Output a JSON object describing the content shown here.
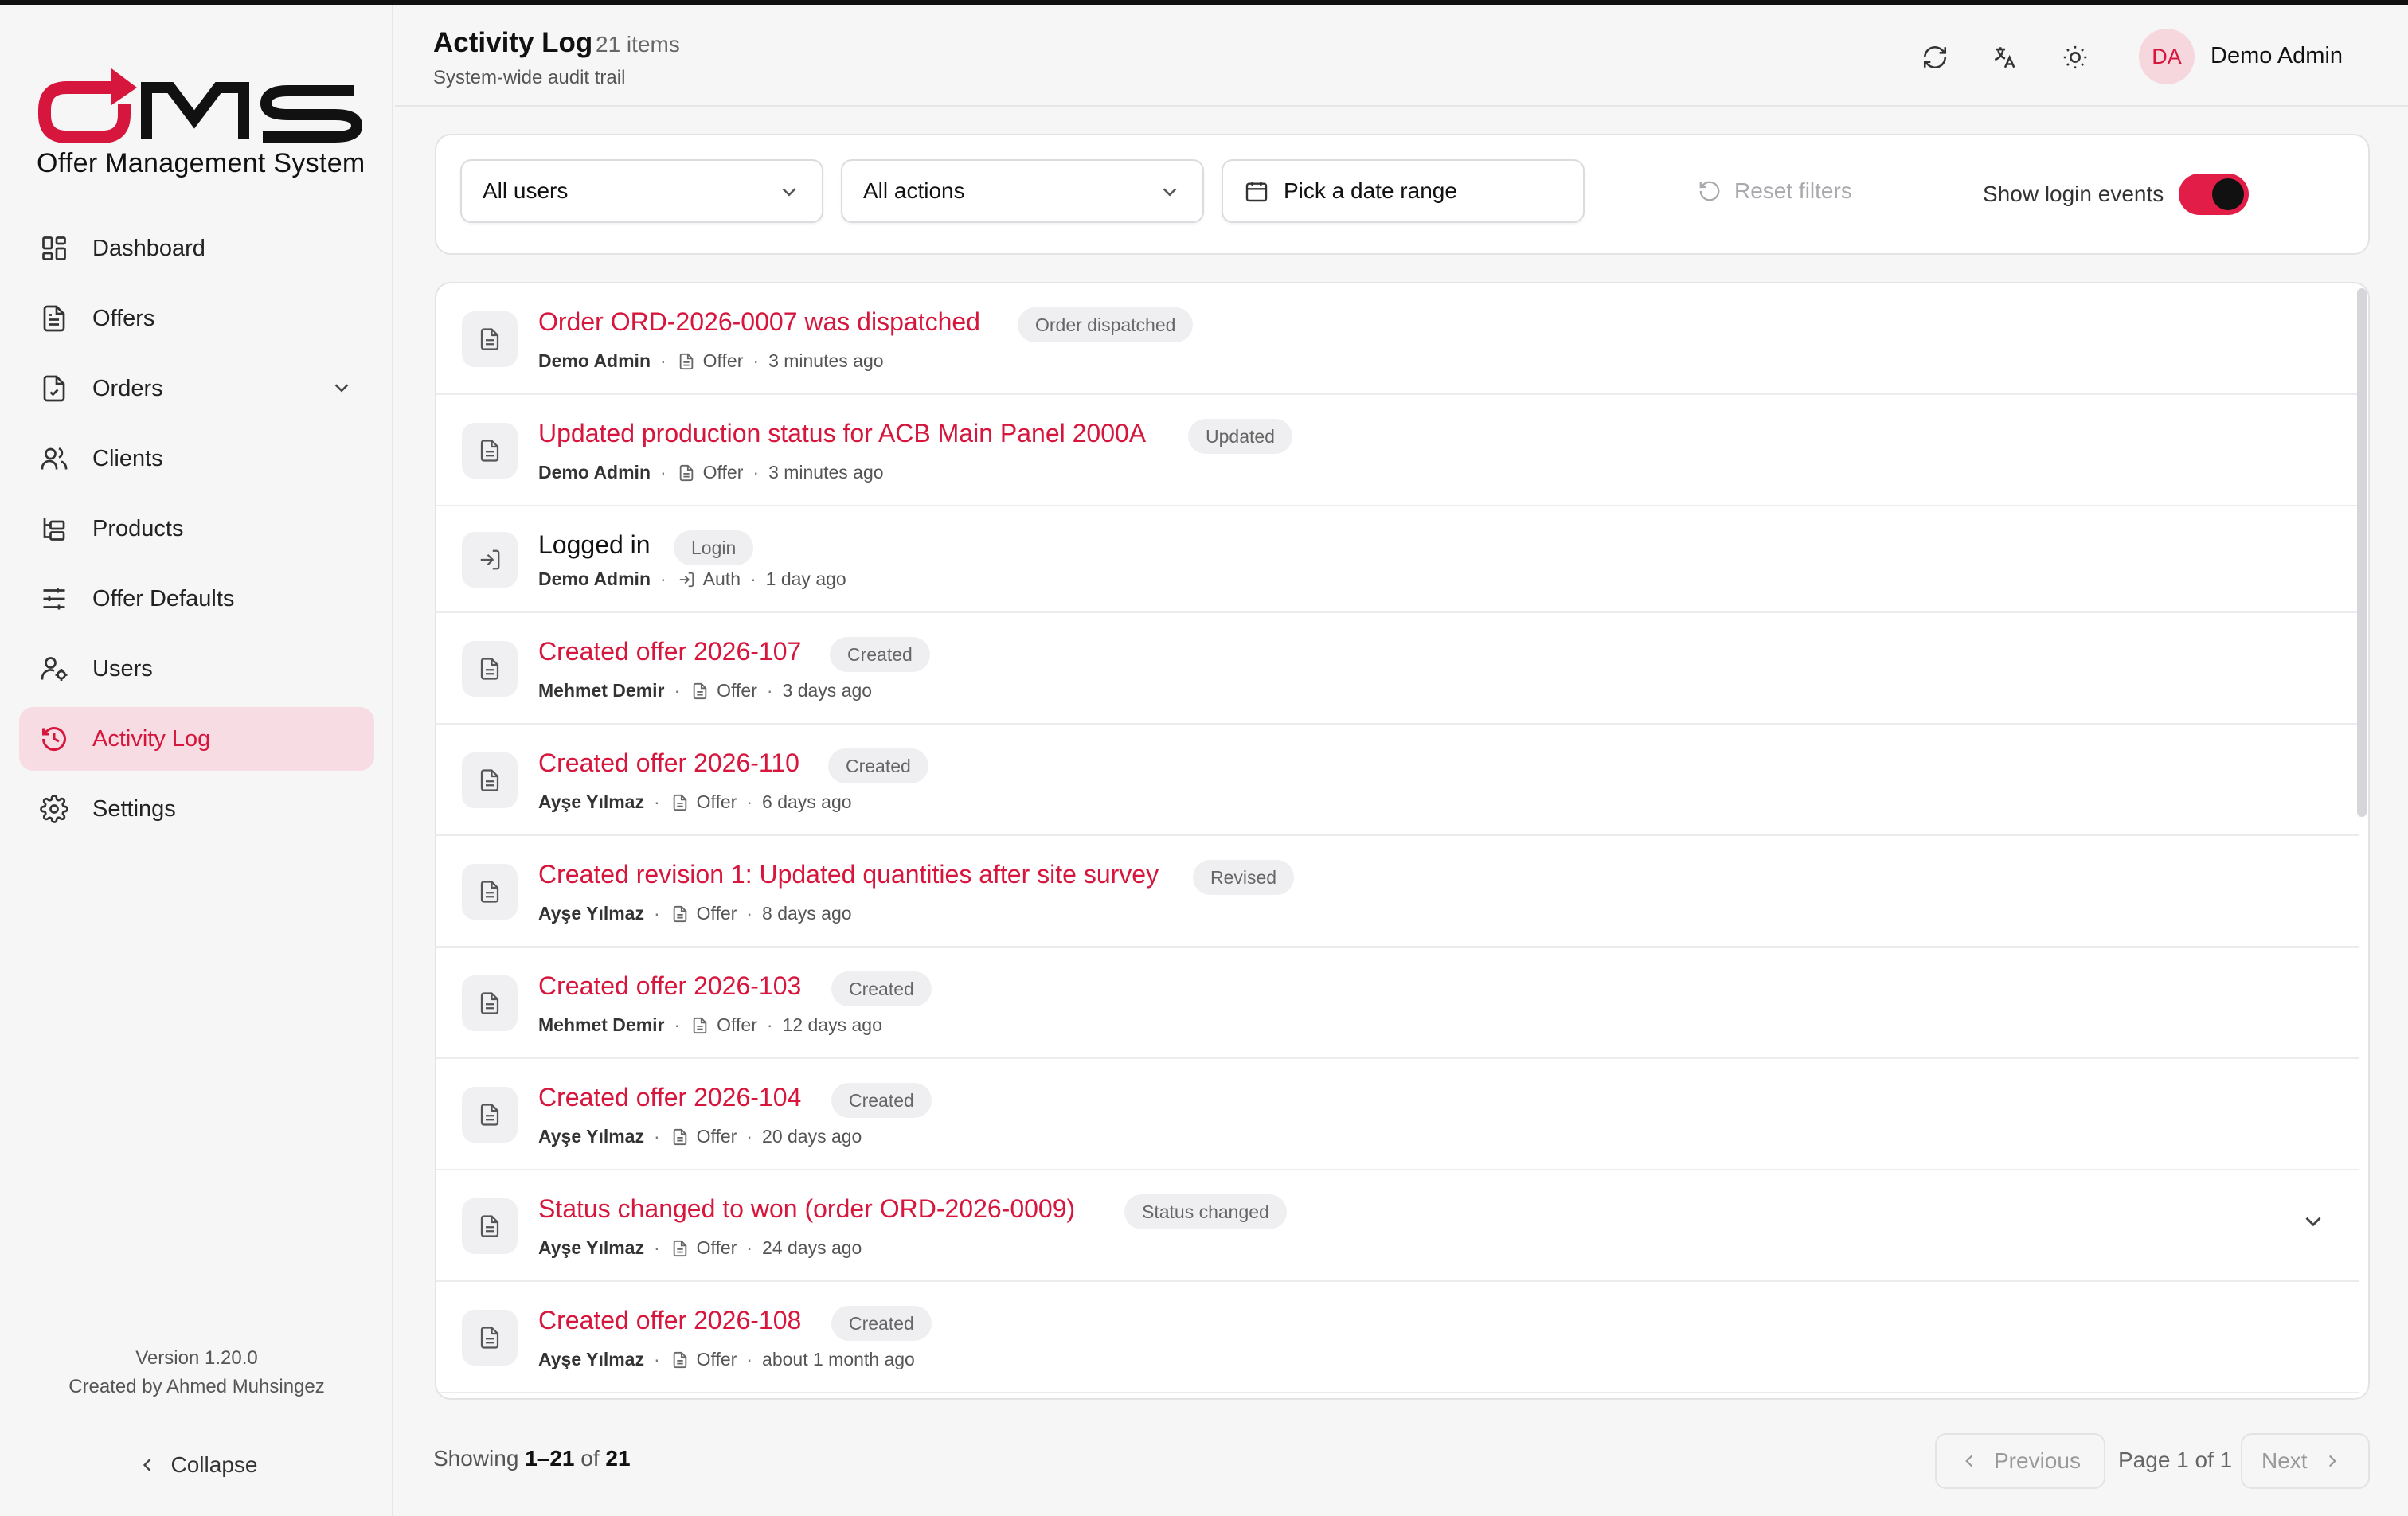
{
  "app": {
    "logo_text": "OMS",
    "logo_subtitle": "Offer Management System",
    "brand_color": "#d6163c"
  },
  "sidebar": {
    "items": [
      {
        "label": "Dashboard",
        "icon": "dashboard-grid-icon"
      },
      {
        "label": "Offers",
        "icon": "document-icon"
      },
      {
        "label": "Orders",
        "icon": "clipboard-check-icon",
        "has_submenu": true
      },
      {
        "label": "Clients",
        "icon": "users-icon"
      },
      {
        "label": "Products",
        "icon": "hierarchy-icon"
      },
      {
        "label": "Offer Defaults",
        "icon": "sliders-icon"
      },
      {
        "label": "Users",
        "icon": "user-gear-icon"
      },
      {
        "label": "Activity Log",
        "icon": "history-icon",
        "active": true
      },
      {
        "label": "Settings",
        "icon": "gear-icon"
      }
    ],
    "version": "Version 1.20.0",
    "credit": "Created by Ahmed Muhsingez",
    "collapse_label": "Collapse"
  },
  "header": {
    "title": "Activity Log",
    "count": "21 items",
    "subtitle": "System-wide audit trail",
    "user_initials": "DA",
    "user_name": "Demo Admin"
  },
  "filters": {
    "user_select": "All users",
    "action_select": "All actions",
    "date_range": "Pick a date range",
    "reset_label": "Reset filters",
    "login_toggle_label": "Show login events",
    "login_toggle_on": true
  },
  "activities": [
    {
      "title": "Order ORD-2026-0007 was dispatched",
      "badge": "Order dispatched",
      "user": "Demo Admin",
      "entity": "Offer",
      "time": "3 minutes ago",
      "type": "offer"
    },
    {
      "title": "Updated production status for ACB Main Panel 2000A",
      "badge": "Updated",
      "user": "Demo Admin",
      "entity": "Offer",
      "time": "3 minutes ago",
      "type": "offer"
    },
    {
      "title": "Logged in",
      "badge": "Login",
      "user": "Demo Admin",
      "entity": "Auth",
      "time": "1 day ago",
      "type": "auth"
    },
    {
      "title": "Created offer 2026-107",
      "badge": "Created",
      "user": "Mehmet Demir",
      "entity": "Offer",
      "time": "3 days ago",
      "type": "offer"
    },
    {
      "title": "Created offer 2026-110",
      "badge": "Created",
      "user": "Ayşe Yılmaz",
      "entity": "Offer",
      "time": "6 days ago",
      "type": "offer"
    },
    {
      "title": "Created revision 1: Updated quantities after site survey",
      "badge": "Revised",
      "user": "Ayşe Yılmaz",
      "entity": "Offer",
      "time": "8 days ago",
      "type": "offer"
    },
    {
      "title": "Created offer 2026-103",
      "badge": "Created",
      "user": "Mehmet Demir",
      "entity": "Offer",
      "time": "12 days ago",
      "type": "offer"
    },
    {
      "title": "Created offer 2026-104",
      "badge": "Created",
      "user": "Ayşe Yılmaz",
      "entity": "Offer",
      "time": "20 days ago",
      "type": "offer"
    },
    {
      "title": "Status changed to won (order ORD-2026-0009)",
      "badge": "Status changed",
      "user": "Ayşe Yılmaz",
      "entity": "Offer",
      "time": "24 days ago",
      "type": "offer",
      "expandable": true
    },
    {
      "title": "Created offer 2026-108",
      "badge": "Created",
      "user": "Ayşe Yılmaz",
      "entity": "Offer",
      "time": "about 1 month ago",
      "type": "offer"
    }
  ],
  "pagination": {
    "showing_prefix": "Showing",
    "range": "1–21",
    "of_word": "of",
    "total": "21",
    "previous_label": "Previous",
    "page_info": "Page 1 of 1",
    "next_label": "Next"
  }
}
